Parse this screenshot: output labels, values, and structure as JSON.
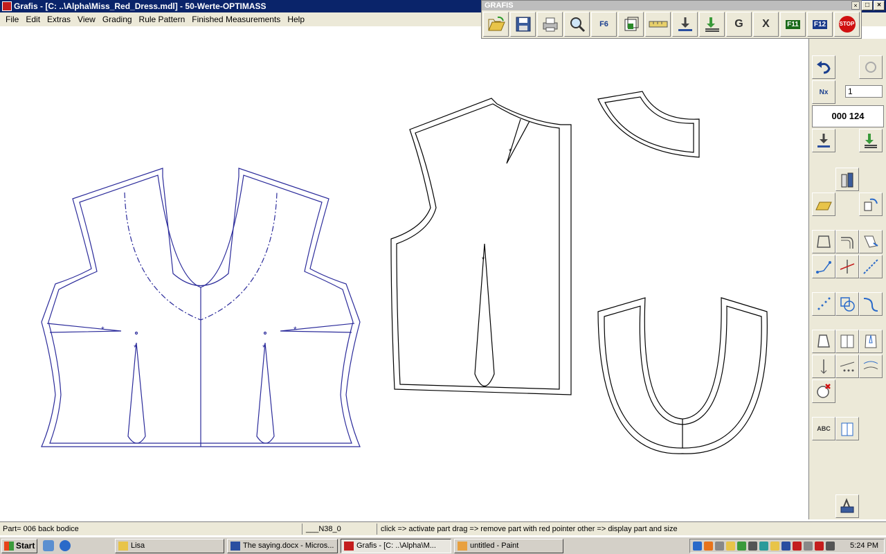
{
  "window": {
    "title": "Grafis - [C: ..\\Alpha\\Miss_Red_Dress.mdl] - 50-Werte-OPTIMASS",
    "controls": [
      "_",
      "□",
      "×"
    ]
  },
  "menu": {
    "items": [
      "File",
      "Edit",
      "Extras",
      "View",
      "Grading",
      "Rule Pattern",
      "Finished Measurements",
      "Help"
    ]
  },
  "grafis_toolbar": {
    "title": "GRAFIS",
    "buttons": [
      {
        "name": "open-icon",
        "label": ""
      },
      {
        "name": "save-icon",
        "label": ""
      },
      {
        "name": "print-icon",
        "label": ""
      },
      {
        "name": "zoom-icon",
        "label": ""
      },
      {
        "name": "f6-icon",
        "label": "F6"
      },
      {
        "name": "layers-icon",
        "label": ""
      },
      {
        "name": "measure-icon",
        "label": ""
      },
      {
        "name": "download-icon",
        "label": ""
      },
      {
        "name": "stack-download-icon",
        "label": ""
      },
      {
        "name": "g-table-icon",
        "label": "G"
      },
      {
        "name": "x-table-icon",
        "label": "X"
      },
      {
        "name": "f11-icon",
        "label": "F11"
      },
      {
        "name": "f12-icon",
        "label": "F12"
      },
      {
        "name": "stop-icon",
        "label": "STOP"
      }
    ]
  },
  "right_panel": {
    "counter_value": "1",
    "part_counter": "000 124",
    "nx_label": "Nx",
    "abc_label": "ABC"
  },
  "status": {
    "part": "Part= 006  back bodice",
    "size": "___N38_0",
    "hint": "click => activate part drag => remove part with red pointer other => display part and size"
  },
  "taskbar": {
    "start_label": "Start",
    "tasks": [
      {
        "label": "Lisa",
        "active": false
      },
      {
        "label": "The saying.docx - Micros...",
        "active": false
      },
      {
        "label": "Grafis - [C: ..\\Alpha\\M...",
        "active": true
      },
      {
        "label": "untitled - Paint",
        "active": false
      }
    ],
    "clock": "5:24 PM"
  },
  "colors": {
    "active_part": "#2a2a9a",
    "inactive_part": "#000000",
    "title_bar": "#0a246a",
    "chrome": "#ece9d8"
  }
}
